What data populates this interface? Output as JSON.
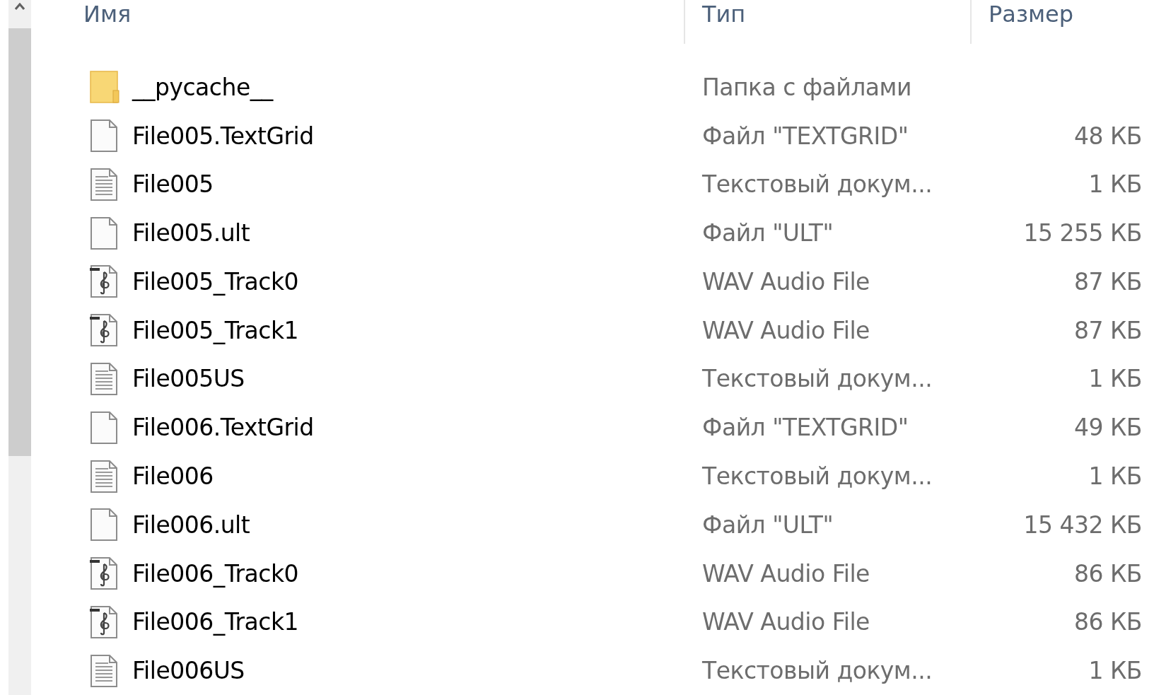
{
  "columns": [
    {
      "label": "Имя"
    },
    {
      "label": "Тип"
    },
    {
      "label": "Размер"
    }
  ],
  "files": [
    {
      "kind": "folder",
      "name": "__pycache__",
      "type": "Папка с файлами"
    },
    {
      "kind": "blank",
      "name": "File005.TextGrid",
      "type": "Файл \"TEXTGRID\"",
      "size": "48 КБ"
    },
    {
      "kind": "text",
      "name": "File005",
      "type": "Текстовый докум...",
      "size": "1 КБ"
    },
    {
      "kind": "blank",
      "name": "File005.ult",
      "type": "Файл \"ULT\"",
      "size": "15 255 КБ"
    },
    {
      "kind": "audio",
      "name": "File005_Track0",
      "type": "WAV Audio File",
      "size": "87 КБ"
    },
    {
      "kind": "audio",
      "name": "File005_Track1",
      "type": "WAV Audio File",
      "size": "87 КБ"
    },
    {
      "kind": "text",
      "name": "File005US",
      "type": "Текстовый докум...",
      "size": "1 КБ"
    },
    {
      "kind": "blank",
      "name": "File006.TextGrid",
      "type": "Файл \"TEXTGRID\"",
      "size": "49 КБ"
    },
    {
      "kind": "text",
      "name": "File006",
      "type": "Текстовый докум...",
      "size": "1 КБ"
    },
    {
      "kind": "blank",
      "name": "File006.ult",
      "type": "Файл \"ULT\"",
      "size": "15 432 КБ"
    },
    {
      "kind": "audio",
      "name": "File006_Track0",
      "type": "WAV Audio File",
      "size": "86 КБ"
    },
    {
      "kind": "audio",
      "name": "File006_Track1",
      "type": "WAV Audio File",
      "size": "86 КБ"
    },
    {
      "kind": "text",
      "name": "File006US",
      "type": "Текстовый докум...",
      "size": "1 КБ"
    }
  ]
}
